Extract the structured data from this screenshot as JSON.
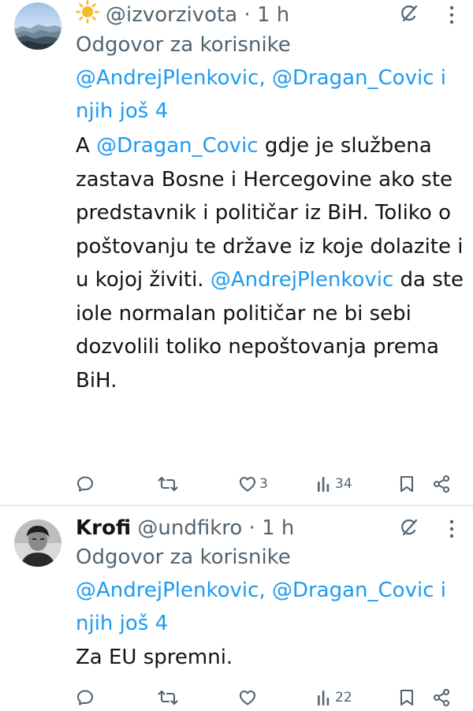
{
  "tweets": [
    {
      "display_name": "",
      "emoji": "☀️",
      "handle": "@izvorzivota",
      "separator": "·",
      "time": "1 h",
      "reply_prefix": "Odgovor za korisnike",
      "reply_mentions": [
        "@AndrejPlenkovic",
        "@Dragan_Covic"
      ],
      "reply_suffix": "i njih još 4",
      "body": {
        "p1": "A",
        "mention1": "@Dragan_Covic",
        "p2": "gdje je službena zastava Bosne i Hercegovine ako ste predstavnik i političar iz BiH. Toliko o poštovanju te države iz koje dolazite i u kojoj živiti.",
        "mention2": "@AndrejPlenkovic",
        "p3": "da ste iole normalan političar ne bi sebi dozvolili toliko nepoštovanja prema BiH."
      },
      "replies": "",
      "reposts": "",
      "likes": "3",
      "views": "34",
      "avatar_icon": "landscape-avatar"
    },
    {
      "display_name": "Krofi",
      "emoji": "",
      "handle": "@undfikro",
      "separator": "·",
      "time": "1 h",
      "reply_prefix": "Odgovor za korisnike",
      "reply_mentions": [
        "@AndrejPlenkovic",
        "@Dragan_Covic"
      ],
      "reply_suffix": "i njih još 4",
      "body": {
        "p1": "Za EU spremni."
      },
      "replies": "",
      "reposts": "",
      "likes": "",
      "views": "22",
      "avatar_icon": "person-photo-avatar"
    }
  ],
  "colors": {
    "text": "#0f1419",
    "secondary": "#536471",
    "link": "#1d9bf0",
    "divider": "#e6e9ec"
  },
  "icons": [
    "grok-icon",
    "more-icon",
    "reply-icon",
    "repost-icon",
    "like-icon",
    "views-icon",
    "bookmark-icon",
    "share-icon",
    "sun-emoji-icon"
  ]
}
